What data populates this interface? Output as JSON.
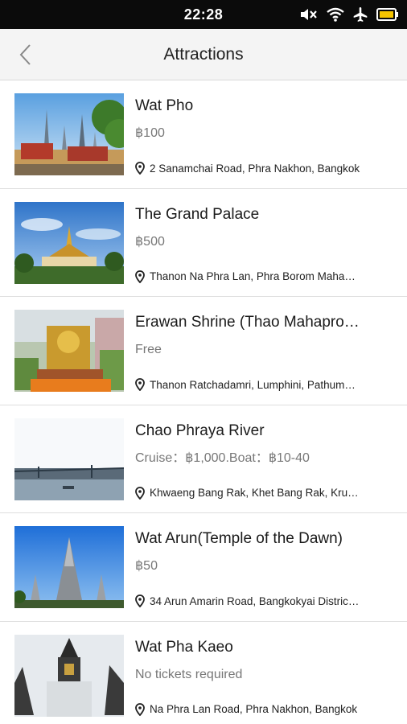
{
  "status": {
    "time": "22:28"
  },
  "nav": {
    "title": "Attractions"
  },
  "icons": {
    "back": "chevron-left-icon",
    "location": "location-pin-icon",
    "mute": "mute-icon",
    "wifi": "wifi-icon",
    "airplane": "airplane-icon",
    "battery": "battery-icon"
  },
  "colors": {
    "battery": "#f5c400",
    "status_bg": "#0b0b0b",
    "nav_bg": "#f4f4f4"
  },
  "attractions": [
    {
      "name": "Wat Pho",
      "price": "฿100",
      "address": "2 Sanamchai Road, Phra Nakhon, Bangkok"
    },
    {
      "name": "The Grand Palace",
      "price": "฿500",
      "address": "Thanon Na Phra Lan, Phra Borom Maha…"
    },
    {
      "name": "Erawan Shrine (Thao Mahapro…",
      "price": "Free",
      "address": "Thanon Ratchadamri, Lumphini, Pathum…"
    },
    {
      "name": "Chao Phraya River",
      "price": "Cruise：฿1,000.Boat：฿10-40",
      "address": "Khwaeng Bang Rak, Khet Bang Rak, Kru…"
    },
    {
      "name": "Wat Arun(Temple of the Dawn)",
      "price": "฿50",
      "address": "34 Arun Amarin Road, Bangkokyai Distric…"
    },
    {
      "name": "Wat Pha Kaeo",
      "price": "No tickets required",
      "address": "Na Phra Lan Road, Phra Nakhon, Bangkok"
    }
  ]
}
